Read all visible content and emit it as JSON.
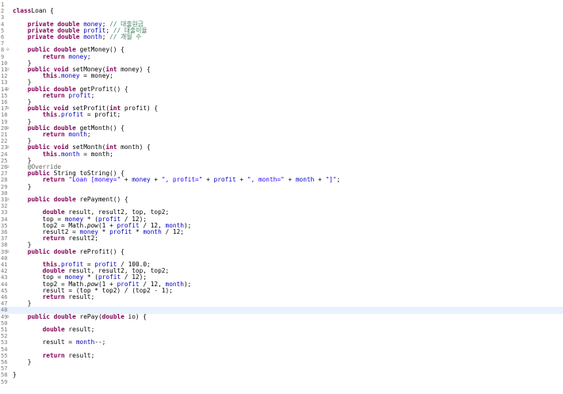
{
  "editor": {
    "highlighted_line": 48,
    "lines": [
      {
        "n": "1",
        "fold": "",
        "t": []
      },
      {
        "n": "2",
        "fold": "",
        "t": [
          [
            "k",
            "class"
          ],
          [
            "",
            "Loan {"
          ]
        ]
      },
      {
        "n": "3",
        "fold": "",
        "t": []
      },
      {
        "n": "4",
        "fold": "",
        "t": [
          [
            "",
            "    "
          ],
          [
            "k",
            "private double "
          ],
          [
            "f",
            "money"
          ],
          [
            "",
            "; "
          ],
          [
            "c",
            "// 대출원금"
          ]
        ]
      },
      {
        "n": "5",
        "fold": "",
        "t": [
          [
            "",
            "    "
          ],
          [
            "k",
            "private double "
          ],
          [
            "f",
            "profit"
          ],
          [
            "",
            "; "
          ],
          [
            "c",
            "// 대출이율"
          ]
        ]
      },
      {
        "n": "6",
        "fold": "",
        "t": [
          [
            "",
            "    "
          ],
          [
            "k",
            "private double "
          ],
          [
            "f",
            "month"
          ],
          [
            "",
            "; "
          ],
          [
            "c",
            "// 개월 수"
          ]
        ]
      },
      {
        "n": "7",
        "fold": "",
        "t": []
      },
      {
        "n": "8",
        "fold": "⊖",
        "t": [
          [
            "",
            "    "
          ],
          [
            "k",
            "public double "
          ],
          [
            "",
            "getMoney() {"
          ]
        ]
      },
      {
        "n": "9",
        "fold": "",
        "t": [
          [
            "",
            "        "
          ],
          [
            "k",
            "return "
          ],
          [
            "f",
            "money"
          ],
          [
            "",
            ";"
          ]
        ]
      },
      {
        "n": "10",
        "fold": "",
        "t": [
          [
            "",
            "    }"
          ]
        ]
      },
      {
        "n": "11",
        "fold": "⊖",
        "t": [
          [
            "",
            "    "
          ],
          [
            "k",
            "public void "
          ],
          [
            "",
            "setMoney("
          ],
          [
            "k",
            "int "
          ],
          [
            "",
            "money) {"
          ]
        ]
      },
      {
        "n": "12",
        "fold": "",
        "t": [
          [
            "",
            "        "
          ],
          [
            "k",
            "this"
          ],
          [
            "",
            "."
          ],
          [
            "f",
            "money"
          ],
          [
            "",
            " = money;"
          ]
        ]
      },
      {
        "n": "13",
        "fold": "",
        "t": [
          [
            "",
            "    }"
          ]
        ]
      },
      {
        "n": "14",
        "fold": "⊖",
        "t": [
          [
            "",
            "    "
          ],
          [
            "k",
            "public double "
          ],
          [
            "",
            "getProfit() {"
          ]
        ]
      },
      {
        "n": "15",
        "fold": "",
        "t": [
          [
            "",
            "        "
          ],
          [
            "k",
            "return "
          ],
          [
            "f",
            "profit"
          ],
          [
            "",
            ";"
          ]
        ]
      },
      {
        "n": "16",
        "fold": "",
        "t": [
          [
            "",
            "    }"
          ]
        ]
      },
      {
        "n": "17",
        "fold": "⊖",
        "t": [
          [
            "",
            "    "
          ],
          [
            "k",
            "public void "
          ],
          [
            "",
            "setProfit("
          ],
          [
            "k",
            "int "
          ],
          [
            "",
            "profit) {"
          ]
        ]
      },
      {
        "n": "18",
        "fold": "",
        "t": [
          [
            "",
            "        "
          ],
          [
            "k",
            "this"
          ],
          [
            "",
            "."
          ],
          [
            "f",
            "profit"
          ],
          [
            "",
            " = profit;"
          ]
        ]
      },
      {
        "n": "19",
        "fold": "",
        "t": [
          [
            "",
            "    }"
          ]
        ]
      },
      {
        "n": "20",
        "fold": "⊖",
        "t": [
          [
            "",
            "    "
          ],
          [
            "k",
            "public double "
          ],
          [
            "",
            "getMonth() {"
          ]
        ]
      },
      {
        "n": "21",
        "fold": "",
        "t": [
          [
            "",
            "        "
          ],
          [
            "k",
            "return "
          ],
          [
            "f",
            "month"
          ],
          [
            "",
            ";"
          ]
        ]
      },
      {
        "n": "22",
        "fold": "",
        "t": [
          [
            "",
            "    }"
          ]
        ]
      },
      {
        "n": "23",
        "fold": "⊖",
        "t": [
          [
            "",
            "    "
          ],
          [
            "k",
            "public void "
          ],
          [
            "",
            "setMonth("
          ],
          [
            "k",
            "int "
          ],
          [
            "",
            "month) {"
          ]
        ]
      },
      {
        "n": "24",
        "fold": "",
        "t": [
          [
            "",
            "        "
          ],
          [
            "k",
            "this"
          ],
          [
            "",
            "."
          ],
          [
            "f",
            "month"
          ],
          [
            "",
            " = month;"
          ]
        ]
      },
      {
        "n": "25",
        "fold": "",
        "t": [
          [
            "",
            "    }"
          ]
        ]
      },
      {
        "n": "26",
        "fold": "⊖",
        "t": [
          [
            "",
            "    "
          ],
          [
            "a",
            "@Override"
          ]
        ]
      },
      {
        "n": "27",
        "fold": "",
        "t": [
          [
            "",
            "    "
          ],
          [
            "k",
            "public "
          ],
          [
            "",
            "String toString() {"
          ]
        ]
      },
      {
        "n": "28",
        "fold": "",
        "t": [
          [
            "",
            "        "
          ],
          [
            "k",
            "return "
          ],
          [
            "s",
            "\"Loan [money=\""
          ],
          [
            "",
            " + "
          ],
          [
            "f",
            "money"
          ],
          [
            "",
            " + "
          ],
          [
            "s",
            "\", profit=\""
          ],
          [
            "",
            " + "
          ],
          [
            "f",
            "profit"
          ],
          [
            "",
            " + "
          ],
          [
            "s",
            "\", month=\""
          ],
          [
            "",
            " + "
          ],
          [
            "f",
            "month"
          ],
          [
            "",
            " + "
          ],
          [
            "s",
            "\"]\""
          ],
          [
            "",
            ";"
          ]
        ]
      },
      {
        "n": "29",
        "fold": "",
        "t": [
          [
            "",
            "    }"
          ]
        ]
      },
      {
        "n": "30",
        "fold": "",
        "t": []
      },
      {
        "n": "31",
        "fold": "⊖",
        "t": [
          [
            "",
            "    "
          ],
          [
            "k",
            "public double "
          ],
          [
            "",
            "rePayment() {"
          ]
        ]
      },
      {
        "n": "32",
        "fold": "",
        "t": []
      },
      {
        "n": "33",
        "fold": "",
        "t": [
          [
            "",
            "        "
          ],
          [
            "k",
            "double "
          ],
          [
            "",
            "result, result2, top, top2;"
          ]
        ]
      },
      {
        "n": "34",
        "fold": "",
        "t": [
          [
            "",
            "        top = "
          ],
          [
            "f",
            "money"
          ],
          [
            "",
            " * ("
          ],
          [
            "f",
            "profit"
          ],
          [
            "",
            " / 12);"
          ]
        ]
      },
      {
        "n": "35",
        "fold": "",
        "t": [
          [
            "",
            "        top2 = Math."
          ],
          [
            "m",
            "pow"
          ],
          [
            "",
            "(1 + "
          ],
          [
            "f",
            "profit"
          ],
          [
            "",
            " / 12, "
          ],
          [
            "f",
            "month"
          ],
          [
            "",
            ");"
          ]
        ]
      },
      {
        "n": "36",
        "fold": "",
        "t": [
          [
            "",
            "        result2 = "
          ],
          [
            "f",
            "money"
          ],
          [
            "",
            " * "
          ],
          [
            "f",
            "profit"
          ],
          [
            "",
            " * "
          ],
          [
            "f",
            "month"
          ],
          [
            "",
            " / 12;"
          ]
        ]
      },
      {
        "n": "37",
        "fold": "",
        "t": [
          [
            "",
            "        "
          ],
          [
            "k",
            "return "
          ],
          [
            "",
            "result2;"
          ]
        ]
      },
      {
        "n": "38",
        "fold": "",
        "t": [
          [
            "",
            "    }"
          ]
        ]
      },
      {
        "n": "39",
        "fold": "⊖",
        "t": [
          [
            "",
            "    "
          ],
          [
            "k",
            "public double "
          ],
          [
            "",
            "reProfit() {"
          ]
        ]
      },
      {
        "n": "40",
        "fold": "",
        "t": []
      },
      {
        "n": "41",
        "fold": "",
        "t": [
          [
            "",
            "        "
          ],
          [
            "k",
            "this"
          ],
          [
            "",
            "."
          ],
          [
            "f",
            "profit"
          ],
          [
            "",
            " = "
          ],
          [
            "f",
            "profit"
          ],
          [
            "",
            " / 100.0;"
          ]
        ]
      },
      {
        "n": "42",
        "fold": "",
        "t": [
          [
            "",
            "        "
          ],
          [
            "k",
            "double "
          ],
          [
            "",
            "result, result2, top, top2;"
          ]
        ]
      },
      {
        "n": "43",
        "fold": "",
        "t": [
          [
            "",
            "        top = "
          ],
          [
            "f",
            "money"
          ],
          [
            "",
            " * ("
          ],
          [
            "f",
            "profit"
          ],
          [
            "",
            " / 12);"
          ]
        ]
      },
      {
        "n": "44",
        "fold": "",
        "t": [
          [
            "",
            "        top2 = Math."
          ],
          [
            "m",
            "pow"
          ],
          [
            "",
            "(1 + "
          ],
          [
            "f",
            "profit"
          ],
          [
            "",
            " / 12, "
          ],
          [
            "f",
            "month"
          ],
          [
            "",
            ");"
          ]
        ]
      },
      {
        "n": "45",
        "fold": "",
        "t": [
          [
            "",
            "        result = (top * top2) / (top2 - 1);"
          ]
        ]
      },
      {
        "n": "46",
        "fold": "",
        "t": [
          [
            "",
            "        "
          ],
          [
            "k",
            "return "
          ],
          [
            "",
            "result;"
          ]
        ]
      },
      {
        "n": "47",
        "fold": "",
        "t": [
          [
            "",
            "    }"
          ]
        ]
      },
      {
        "n": "48",
        "fold": "",
        "t": []
      },
      {
        "n": "49",
        "fold": "⊖",
        "t": [
          [
            "",
            "    "
          ],
          [
            "k",
            "public double "
          ],
          [
            "",
            "rePay("
          ],
          [
            "k",
            "double "
          ],
          [
            "",
            "io) {"
          ]
        ]
      },
      {
        "n": "50",
        "fold": "",
        "t": []
      },
      {
        "n": "51",
        "fold": "",
        "t": [
          [
            "",
            "        "
          ],
          [
            "k",
            "double "
          ],
          [
            "",
            "result;"
          ]
        ]
      },
      {
        "n": "52",
        "fold": "",
        "t": []
      },
      {
        "n": "53",
        "fold": "",
        "t": [
          [
            "",
            "        result = "
          ],
          [
            "f",
            "month"
          ],
          [
            "",
            "--;"
          ]
        ]
      },
      {
        "n": "54",
        "fold": "",
        "t": []
      },
      {
        "n": "55",
        "fold": "",
        "t": [
          [
            "",
            "        "
          ],
          [
            "k",
            "return "
          ],
          [
            "",
            "result;"
          ]
        ]
      },
      {
        "n": "56",
        "fold": "",
        "t": [
          [
            "",
            "    }"
          ]
        ]
      },
      {
        "n": "57",
        "fold": "",
        "t": []
      },
      {
        "n": "58",
        "fold": "",
        "t": [
          [
            "",
            "}"
          ]
        ]
      },
      {
        "n": "59",
        "fold": "",
        "t": []
      }
    ]
  }
}
